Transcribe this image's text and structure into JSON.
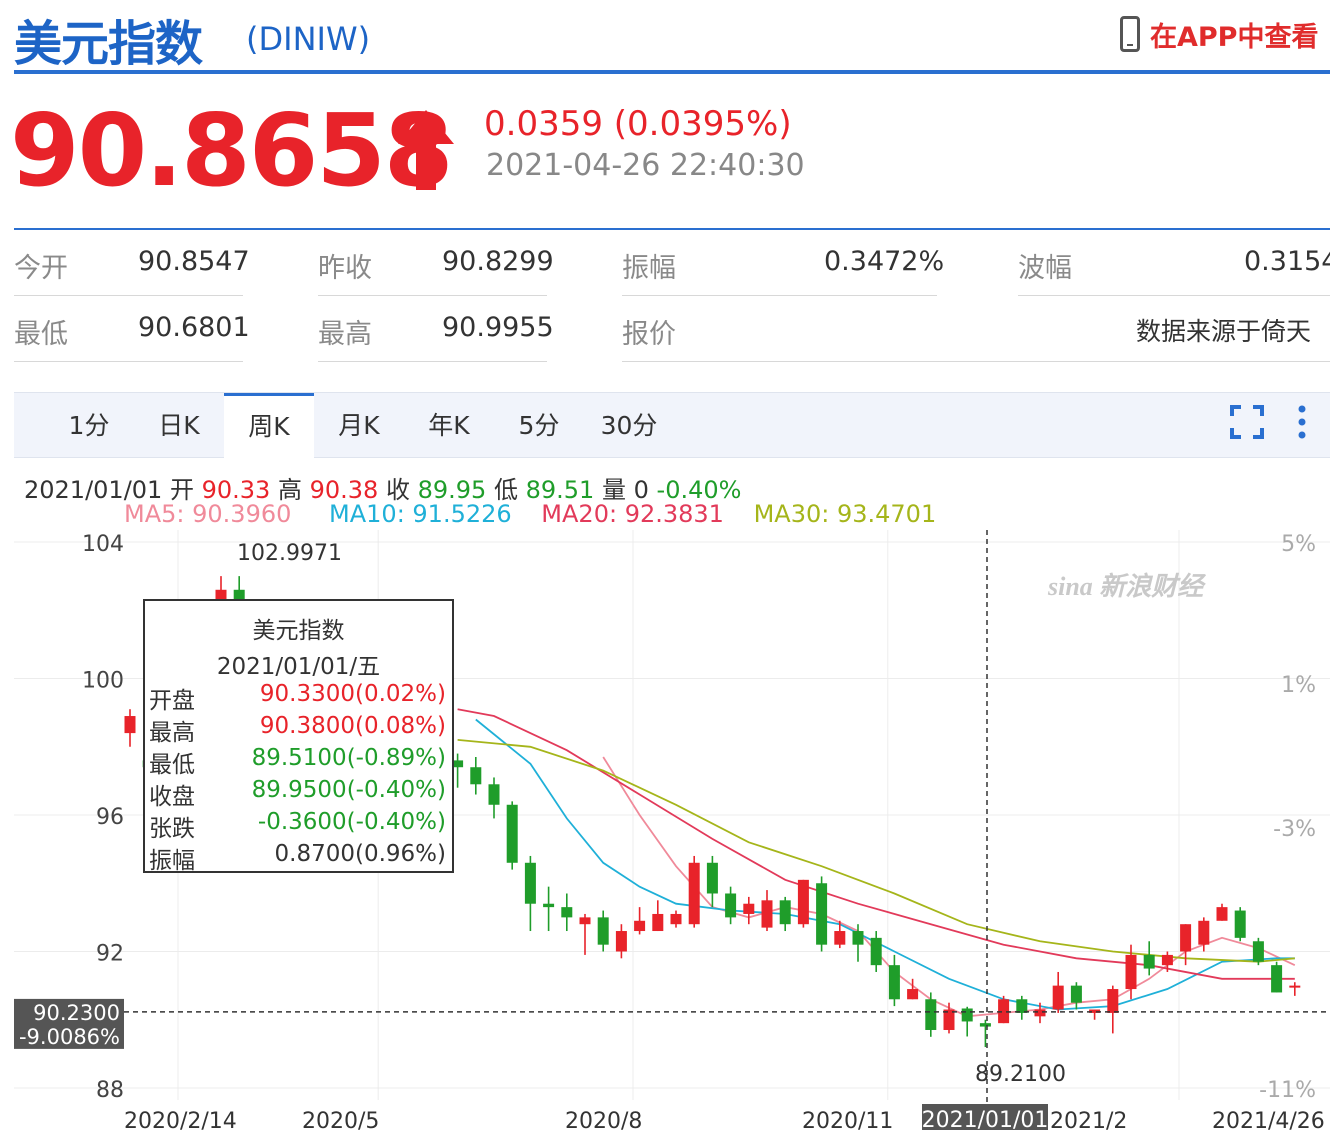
{
  "header": {
    "title": "美元指数",
    "code": "(DINIW)",
    "app_link": "在APP中查看"
  },
  "quote": {
    "price": "90.8658",
    "change": "0.0359 (0.0395%)",
    "timestamp": "2021-04-26 22:40:30"
  },
  "stats": [
    {
      "label": "今开",
      "value": "90.8547"
    },
    {
      "label": "昨收",
      "value": "90.8299"
    },
    {
      "label": "振幅",
      "value": "0.3472%"
    },
    {
      "label": "波幅",
      "value": "0.3154"
    },
    {
      "label": "最低",
      "value": "90.6801"
    },
    {
      "label": "最高",
      "value": "90.9955"
    },
    {
      "label": "报价",
      "value": "数据来源于倚天"
    }
  ],
  "tabs": [
    {
      "label": "1分"
    },
    {
      "label": "日K"
    },
    {
      "label": "周K"
    },
    {
      "label": "月K"
    },
    {
      "label": "年K"
    },
    {
      "label": "5分"
    },
    {
      "label": "30分"
    }
  ],
  "active_tab": "周K",
  "info": {
    "date": "2021/01/01",
    "open_label": "开",
    "open": "90.33",
    "high_label": "高",
    "high": "90.38",
    "close_label": "收",
    "close": "89.95",
    "low_label": "低",
    "low": "89.51",
    "vol_label": "量",
    "vol": "0",
    "pct": "-0.40%"
  },
  "ma": [
    {
      "label": "MA5",
      "value": "90.3960",
      "color": "#f08a9a"
    },
    {
      "label": "MA10",
      "value": "91.5226",
      "color": "#1fb0d8"
    },
    {
      "label": "MA20",
      "value": "92.3831",
      "color": "#e23a5a"
    },
    {
      "label": "MA30",
      "value": "93.4701",
      "color": "#a5b51a"
    }
  ],
  "tooltip": {
    "title": "美元指数",
    "date": "2021/01/01/五",
    "rows": [
      {
        "label": "开盘",
        "value": "90.3300(0.02%)",
        "color": "#e8232a"
      },
      {
        "label": "最高",
        "value": "90.3800(0.08%)",
        "color": "#e8232a"
      },
      {
        "label": "最低",
        "value": "89.5100(-0.89%)",
        "color": "#1f9d2a"
      },
      {
        "label": "收盘",
        "value": "89.9500(-0.40%)",
        "color": "#1f9d2a"
      },
      {
        "label": "张跌",
        "value": "-0.3600(-0.40%)",
        "color": "#1f9d2a"
      },
      {
        "label": "振幅",
        "value": "0.8700(0.96%)",
        "color": "#333333"
      }
    ]
  },
  "chart_data": {
    "type": "candlestick",
    "watermark": "sina 新浪财经",
    "y_ticks": [
      "104",
      "100",
      "96",
      "92",
      "88"
    ],
    "y_right_ticks": [
      "5%",
      "1%",
      "-3%",
      "-11%"
    ],
    "x_ticks": [
      "2020/2/14",
      "2020/5",
      "2020/8",
      "2020/11",
      "2021/01/01",
      "2021/2",
      "2021/4/26"
    ],
    "ylim": [
      88,
      104
    ],
    "max_label": "102.9971",
    "min_label": "89.2100",
    "crosshair": {
      "date": "2021/01/01",
      "price": "90.2300",
      "pct": "-9.0086%"
    },
    "candles": [
      [
        98.4,
        98.9,
        98.0,
        99.1
      ],
      [
        97.6,
        97.4,
        97.0,
        97.8
      ],
      [
        96.5,
        96.3,
        96.0,
        96.9
      ],
      [
        97.4,
        98.2,
        97.2,
        98.5
      ],
      [
        97.8,
        97.3,
        97.0,
        98.0
      ],
      [
        102.2,
        102.6,
        101.8,
        103.0
      ],
      [
        102.6,
        99.5,
        99.1,
        103.0
      ],
      [
        99.5,
        98.8,
        98.0,
        100.2
      ],
      [
        98.8,
        99.8,
        98.5,
        100.1
      ],
      [
        99.8,
        99.4,
        99.0,
        100.2
      ],
      [
        99.4,
        99.6,
        98.5,
        99.9
      ],
      [
        99.6,
        99.2,
        98.8,
        99.9
      ],
      [
        99.2,
        98.9,
        98.5,
        99.5
      ],
      [
        98.9,
        98.7,
        98.2,
        99.3
      ],
      [
        98.7,
        98.4,
        97.9,
        99.0
      ],
      [
        98.4,
        98.0,
        97.5,
        98.7
      ],
      [
        98.0,
        97.2,
        96.8,
        98.3
      ],
      [
        97.2,
        97.6,
        96.8,
        97.8
      ],
      [
        97.6,
        97.4,
        96.8,
        97.8
      ],
      [
        97.4,
        96.9,
        96.6,
        97.7
      ],
      [
        96.9,
        96.3,
        95.9,
        97.1
      ],
      [
        96.3,
        94.6,
        94.4,
        96.4
      ],
      [
        94.6,
        93.4,
        92.6,
        94.8
      ],
      [
        93.4,
        93.3,
        92.6,
        93.9
      ],
      [
        93.3,
        93.0,
        92.6,
        93.7
      ],
      [
        92.8,
        93.0,
        91.9,
        93.1
      ],
      [
        93.0,
        92.2,
        92.0,
        93.2
      ],
      [
        92.0,
        92.6,
        91.8,
        92.8
      ],
      [
        92.6,
        92.9,
        92.5,
        93.3
      ],
      [
        92.6,
        93.1,
        92.6,
        93.5
      ],
      [
        92.8,
        93.1,
        92.7,
        93.2
      ],
      [
        92.8,
        94.6,
        92.7,
        94.8
      ],
      [
        94.6,
        93.7,
        93.3,
        94.8
      ],
      [
        93.7,
        93.0,
        92.8,
        93.9
      ],
      [
        93.1,
        93.4,
        92.8,
        93.6
      ],
      [
        92.7,
        93.5,
        92.6,
        93.8
      ],
      [
        93.5,
        92.8,
        92.6,
        93.6
      ],
      [
        92.8,
        94.1,
        92.7,
        94.1
      ],
      [
        94.0,
        92.2,
        92.0,
        94.2
      ],
      [
        92.2,
        92.6,
        92.1,
        92.9
      ],
      [
        92.6,
        92.2,
        91.7,
        92.8
      ],
      [
        92.4,
        91.6,
        91.4,
        92.6
      ],
      [
        91.6,
        90.6,
        90.4,
        91.9
      ],
      [
        90.6,
        90.9,
        90.6,
        91.2
      ],
      [
        90.6,
        89.7,
        89.5,
        90.8
      ],
      [
        89.7,
        90.3,
        89.6,
        90.5
      ],
      [
        90.33,
        89.95,
        89.51,
        90.38
      ],
      [
        89.9,
        89.8,
        89.2,
        90.0
      ],
      [
        89.9,
        90.6,
        89.9,
        90.7
      ],
      [
        90.6,
        90.2,
        90.0,
        90.7
      ],
      [
        90.1,
        90.3,
        89.9,
        90.5
      ],
      [
        90.3,
        91.0,
        90.2,
        91.4
      ],
      [
        91.0,
        90.5,
        90.3,
        91.1
      ],
      [
        90.2,
        90.3,
        90.0,
        90.3
      ],
      [
        90.2,
        90.9,
        89.6,
        91.0
      ],
      [
        90.9,
        91.9,
        90.6,
        92.2
      ],
      [
        91.9,
        91.5,
        91.3,
        92.3
      ],
      [
        91.6,
        91.9,
        91.4,
        92.0
      ],
      [
        92.0,
        92.8,
        91.6,
        92.8
      ],
      [
        92.2,
        92.9,
        92.0,
        93.0
      ],
      [
        92.9,
        93.3,
        92.9,
        93.4
      ],
      [
        93.2,
        92.4,
        92.3,
        93.3
      ],
      [
        92.3,
        91.7,
        91.6,
        92.4
      ],
      [
        91.6,
        90.8,
        90.8,
        91.7
      ],
      [
        91.0,
        91.0,
        90.7,
        91.1
      ]
    ],
    "series": [
      {
        "name": "MA5",
        "values": [
          [
            26,
            97.7
          ],
          [
            28,
            96.0
          ],
          [
            30,
            94.5
          ],
          [
            32,
            93.3
          ],
          [
            34,
            93.0
          ],
          [
            36,
            93.3
          ],
          [
            38,
            93.1
          ],
          [
            40,
            92.6
          ],
          [
            42,
            91.4
          ],
          [
            44,
            90.6
          ],
          [
            46,
            90.1
          ],
          [
            48,
            90.2
          ],
          [
            50,
            90.3
          ],
          [
            52,
            90.5
          ],
          [
            54,
            90.6
          ],
          [
            56,
            91.2
          ],
          [
            58,
            92.0
          ],
          [
            60,
            92.4
          ],
          [
            62,
            92.1
          ],
          [
            64,
            91.6
          ]
        ]
      },
      {
        "name": "MA10",
        "values": [
          [
            19,
            98.8
          ],
          [
            22,
            97.5
          ],
          [
            24,
            95.9
          ],
          [
            26,
            94.6
          ],
          [
            28,
            93.9
          ],
          [
            30,
            93.4
          ],
          [
            33,
            93.2
          ],
          [
            36,
            93.1
          ],
          [
            39,
            92.8
          ],
          [
            42,
            92.0
          ],
          [
            45,
            91.2
          ],
          [
            48,
            90.6
          ],
          [
            51,
            90.3
          ],
          [
            54,
            90.4
          ],
          [
            57,
            90.9
          ],
          [
            60,
            91.7
          ],
          [
            63,
            91.8
          ],
          [
            64,
            91.8
          ]
        ]
      },
      {
        "name": "MA20",
        "values": [
          [
            18,
            99.1
          ],
          [
            20,
            98.9
          ],
          [
            24,
            97.9
          ],
          [
            28,
            96.6
          ],
          [
            32,
            95.3
          ],
          [
            36,
            94.1
          ],
          [
            40,
            93.4
          ],
          [
            44,
            92.8
          ],
          [
            48,
            92.2
          ],
          [
            52,
            91.8
          ],
          [
            56,
            91.6
          ],
          [
            60,
            91.2
          ],
          [
            64,
            91.2
          ]
        ]
      },
      {
        "name": "MA30",
        "values": [
          [
            18,
            98.2
          ],
          [
            22,
            98.0
          ],
          [
            26,
            97.3
          ],
          [
            30,
            96.3
          ],
          [
            34,
            95.2
          ],
          [
            38,
            94.5
          ],
          [
            42,
            93.7
          ],
          [
            46,
            92.8
          ],
          [
            50,
            92.3
          ],
          [
            54,
            92.0
          ],
          [
            58,
            91.8
          ],
          [
            62,
            91.7
          ],
          [
            64,
            91.8
          ]
        ]
      }
    ]
  }
}
